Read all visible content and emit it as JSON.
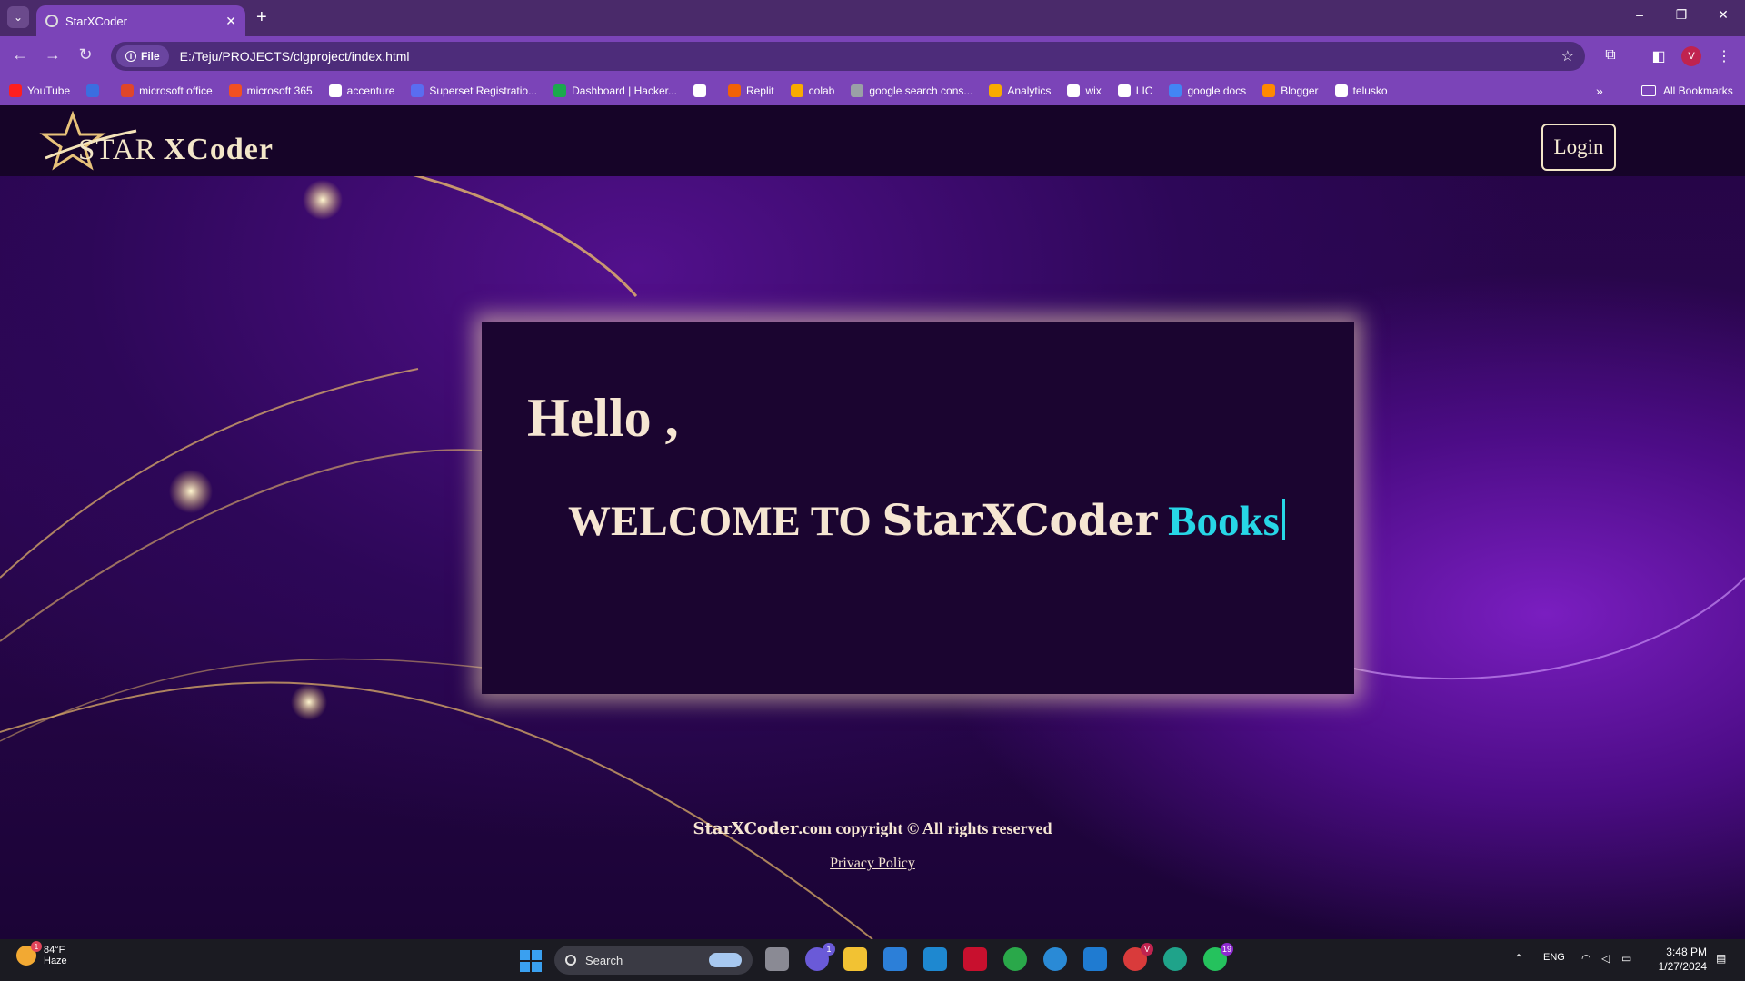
{
  "browser": {
    "tab_title": "StarXCoder",
    "url_chip": "File",
    "url": "E:/Teju/PROJECTS/clgproject/index.html",
    "profile_initial": "V",
    "bookmarks": [
      {
        "label": "YouTube",
        "icon": "youtube-icon",
        "color": "#ff1f1f"
      },
      {
        "label": "",
        "icon": "search-engine-icon",
        "color": "#3b6ee0"
      },
      {
        "label": "microsoft office",
        "icon": "office-icon",
        "color": "#e0462a"
      },
      {
        "label": "microsoft 365",
        "icon": "microsoft-icon",
        "color": "#f25022"
      },
      {
        "label": "accenture",
        "icon": "globe-icon",
        "color": "#ffffff"
      },
      {
        "label": "Superset Registratio...",
        "icon": "superset-icon",
        "color": "#5a6df0"
      },
      {
        "label": "Dashboard | Hacker...",
        "icon": "hackerrank-icon",
        "color": "#1ba94c"
      },
      {
        "label": "",
        "icon": "globe-icon",
        "color": "#ffffff"
      },
      {
        "label": "Replit",
        "icon": "replit-icon",
        "color": "#f26207"
      },
      {
        "label": "colab",
        "icon": "colab-icon",
        "color": "#f9ab00"
      },
      {
        "label": "google search cons...",
        "icon": "search-console-icon",
        "color": "#9aa0a6"
      },
      {
        "label": "Analytics",
        "icon": "analytics-icon",
        "color": "#f9ab00"
      },
      {
        "label": "wix",
        "icon": "wix-icon",
        "color": "#ffffff"
      },
      {
        "label": "LIC",
        "icon": "globe-icon",
        "color": "#ffffff"
      },
      {
        "label": "google docs",
        "icon": "docs-icon",
        "color": "#4285f4"
      },
      {
        "label": "Blogger",
        "icon": "blogger-icon",
        "color": "#ff8a00"
      },
      {
        "label": "telusko",
        "icon": "telusko-icon",
        "color": "#ffffff"
      }
    ],
    "all_bookmarks": "All Bookmarks"
  },
  "page": {
    "logo_star_text": "STAR",
    "logo_x_text": "XCoder",
    "login_label": "Login",
    "hello": "Hello ,",
    "welcome_prefix": "WELCOME TO ",
    "welcome_brand": "StarXCoder",
    "welcome_typed": "Books",
    "footer_brand": "StarXCoder",
    "footer_rest": ".com copyright © All rights reserved",
    "privacy": "Privacy Policy"
  },
  "taskbar": {
    "weather_temp": "84°F",
    "weather_desc": "Haze",
    "weather_badge": "1",
    "search_placeholder": "Search",
    "teams_badge": "1",
    "chrome_badge": "V",
    "whatsapp_badge": "19",
    "lang": "ENG",
    "time": "3:48 PM",
    "date": "1/27/2024"
  },
  "colors": {
    "accent_cyan": "#27d6e6",
    "cream_text": "#f6e6d2",
    "browser_purple": "#7b44b8"
  }
}
